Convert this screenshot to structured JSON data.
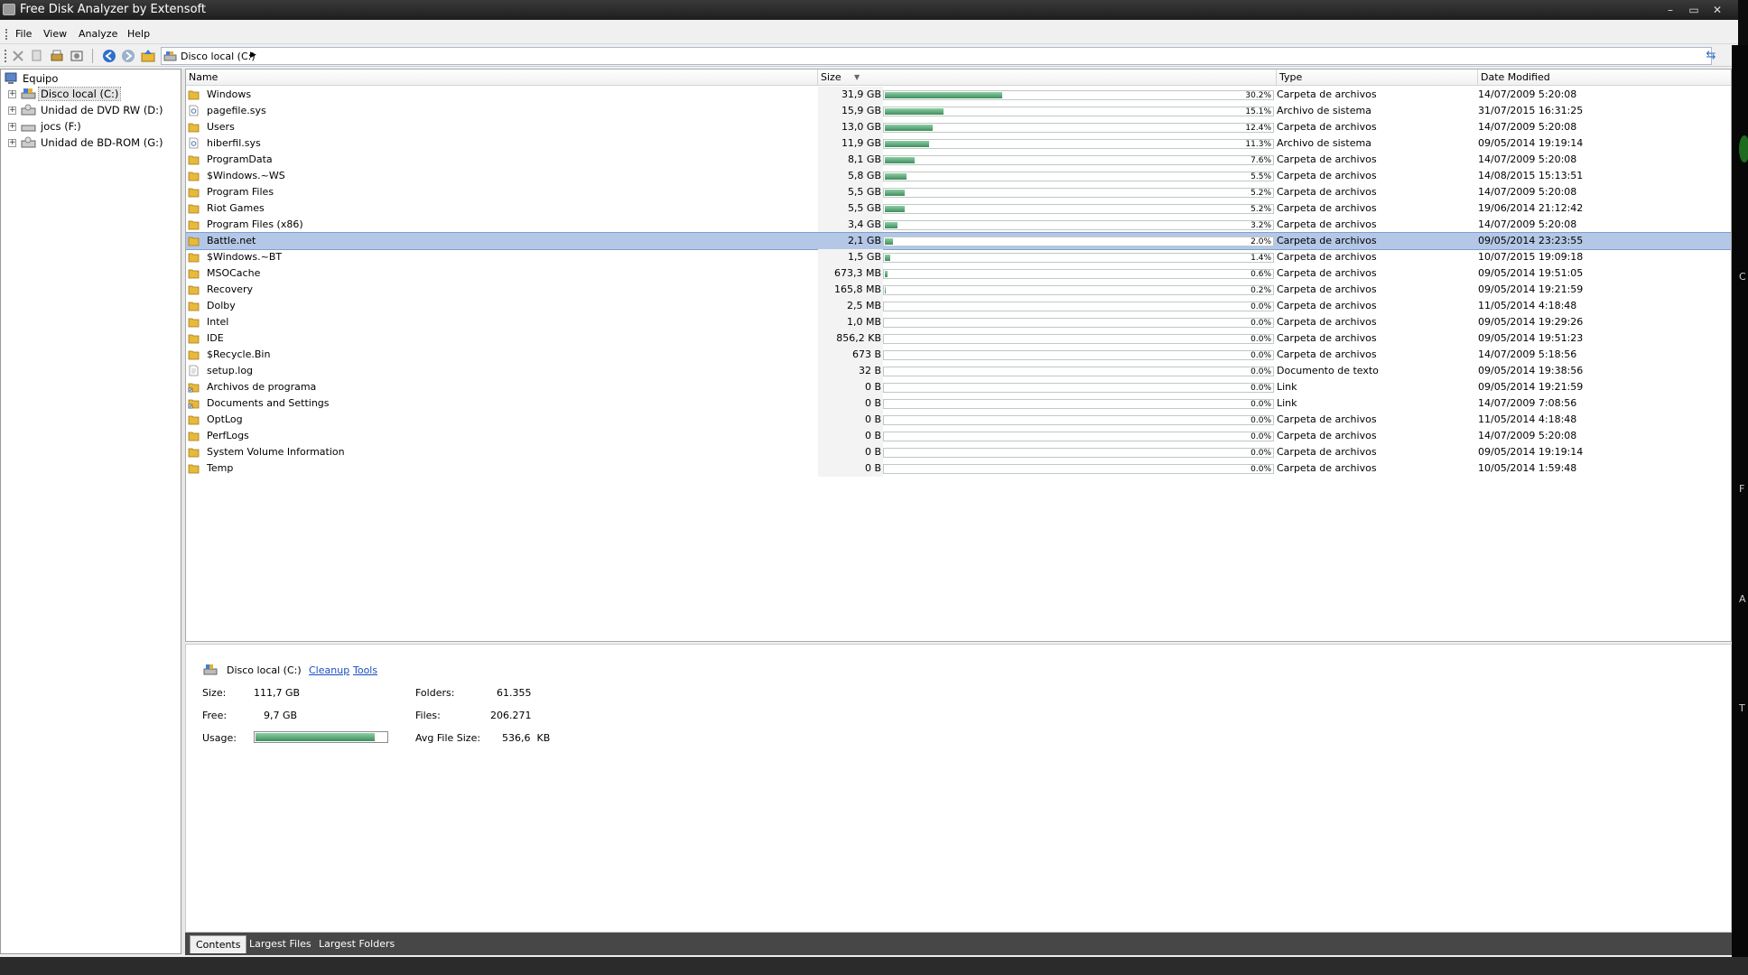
{
  "window": {
    "title": "Free Disk Analyzer by Extensoft",
    "controls": {
      "minimize": "–",
      "restore": "▭",
      "close": "✕"
    }
  },
  "menu": {
    "items": [
      "File",
      "View",
      "Analyze",
      "Help"
    ]
  },
  "address": {
    "path": "Disco local (C:)",
    "arrow": "▶"
  },
  "tree": {
    "root": "Equipo",
    "items": [
      {
        "label": "Disco local (C:)",
        "selected": true
      },
      {
        "label": "Unidad de DVD RW (D:)"
      },
      {
        "label": "jocs (F:)"
      },
      {
        "label": "Unidad de BD-ROM (G:)"
      }
    ]
  },
  "list": {
    "columns": {
      "name": "Name",
      "size": "Size",
      "type": "Type",
      "date": "Date Modified"
    },
    "rows": [
      {
        "name": "Windows",
        "icon": "folder",
        "size": "31,9 GB",
        "pct": "30.2%",
        "frac": 0.302,
        "type": "Carpeta de archivos",
        "date": "14/07/2009 5:20:08"
      },
      {
        "name": "pagefile.sys",
        "icon": "system-file",
        "size": "15,9 GB",
        "pct": "15.1%",
        "frac": 0.151,
        "type": "Archivo de sistema",
        "date": "31/07/2015 16:31:25"
      },
      {
        "name": "Users",
        "icon": "folder",
        "size": "13,0 GB",
        "pct": "12.4%",
        "frac": 0.124,
        "type": "Carpeta de archivos",
        "date": "14/07/2009 5:20:08"
      },
      {
        "name": "hiberfil.sys",
        "icon": "system-file",
        "size": "11,9 GB",
        "pct": "11.3%",
        "frac": 0.113,
        "type": "Archivo de sistema",
        "date": "09/05/2014 19:19:14"
      },
      {
        "name": "ProgramData",
        "icon": "folder",
        "size": "8,1 GB",
        "pct": "7.6%",
        "frac": 0.076,
        "type": "Carpeta de archivos",
        "date": "14/07/2009 5:20:08"
      },
      {
        "name": "$Windows.~WS",
        "icon": "folder",
        "size": "5,8 GB",
        "pct": "5.5%",
        "frac": 0.055,
        "type": "Carpeta de archivos",
        "date": "14/08/2015 15:13:51"
      },
      {
        "name": "Program Files",
        "icon": "folder",
        "size": "5,5 GB",
        "pct": "5.2%",
        "frac": 0.052,
        "type": "Carpeta de archivos",
        "date": "14/07/2009 5:20:08"
      },
      {
        "name": "Riot Games",
        "icon": "folder",
        "size": "5,5 GB",
        "pct": "5.2%",
        "frac": 0.052,
        "type": "Carpeta de archivos",
        "date": "19/06/2014 21:12:42"
      },
      {
        "name": "Program Files (x86)",
        "icon": "folder",
        "size": "3,4 GB",
        "pct": "3.2%",
        "frac": 0.032,
        "type": "Carpeta de archivos",
        "date": "14/07/2009 5:20:08"
      },
      {
        "name": "Battle.net",
        "icon": "folder",
        "size": "2,1 GB",
        "pct": "2.0%",
        "frac": 0.02,
        "type": "Carpeta de archivos",
        "date": "09/05/2014 23:23:55",
        "selected": true
      },
      {
        "name": "$Windows.~BT",
        "icon": "folder",
        "size": "1,5 GB",
        "pct": "1.4%",
        "frac": 0.014,
        "type": "Carpeta de archivos",
        "date": "10/07/2015 19:09:18"
      },
      {
        "name": "MSOCache",
        "icon": "folder",
        "size": "673,3 MB",
        "pct": "0.6%",
        "frac": 0.006,
        "type": "Carpeta de archivos",
        "date": "09/05/2014 19:51:05"
      },
      {
        "name": "Recovery",
        "icon": "folder",
        "size": "165,8 MB",
        "pct": "0.2%",
        "frac": 0.002,
        "type": "Carpeta de archivos",
        "date": "09/05/2014 19:21:59"
      },
      {
        "name": "Dolby",
        "icon": "folder",
        "size": "2,5 MB",
        "pct": "0.0%",
        "frac": 0,
        "type": "Carpeta de archivos",
        "date": "11/05/2014 4:18:48"
      },
      {
        "name": "Intel",
        "icon": "folder",
        "size": "1,0 MB",
        "pct": "0.0%",
        "frac": 0,
        "type": "Carpeta de archivos",
        "date": "09/05/2014 19:29:26"
      },
      {
        "name": "IDE",
        "icon": "folder",
        "size": "856,2 KB",
        "pct": "0.0%",
        "frac": 0,
        "type": "Carpeta de archivos",
        "date": "09/05/2014 19:51:23"
      },
      {
        "name": "$Recycle.Bin",
        "icon": "folder",
        "size": "673 B",
        "pct": "0.0%",
        "frac": 0,
        "type": "Carpeta de archivos",
        "date": "14/07/2009 5:18:56"
      },
      {
        "name": "setup.log",
        "icon": "text-file",
        "size": "32 B",
        "pct": "0.0%",
        "frac": 0,
        "type": "Documento de texto",
        "date": "09/05/2014 19:38:56"
      },
      {
        "name": "Archivos de programa",
        "icon": "folder-link",
        "size": "0 B",
        "pct": "0.0%",
        "frac": 0,
        "type": "Link",
        "date": "09/05/2014 19:21:59"
      },
      {
        "name": "Documents and Settings",
        "icon": "folder-link",
        "size": "0 B",
        "pct": "0.0%",
        "frac": 0,
        "type": "Link",
        "date": "14/07/2009 7:08:56"
      },
      {
        "name": "OptLog",
        "icon": "folder",
        "size": "0 B",
        "pct": "0.0%",
        "frac": 0,
        "type": "Carpeta de archivos",
        "date": "11/05/2014 4:18:48"
      },
      {
        "name": "PerfLogs",
        "icon": "folder",
        "size": "0 B",
        "pct": "0.0%",
        "frac": 0,
        "type": "Carpeta de archivos",
        "date": "14/07/2009 5:20:08"
      },
      {
        "name": "System Volume Information",
        "icon": "folder",
        "size": "0 B",
        "pct": "0.0%",
        "frac": 0,
        "type": "Carpeta de archivos",
        "date": "09/05/2014 19:19:14"
      },
      {
        "name": "Temp",
        "icon": "folder",
        "size": "0 B",
        "pct": "0.0%",
        "frac": 0,
        "type": "Carpeta de archivos",
        "date": "10/05/2014 1:59:48"
      }
    ]
  },
  "info": {
    "drive": "Disco local (C:)",
    "cleanup": "Cleanup",
    "tools": "Tools",
    "size_label": "Size:",
    "size_value": "111,7 GB",
    "free_label": "Free:",
    "free_value": "9,7 GB",
    "usage_label": "Usage:",
    "usage_fraction": 0.913,
    "folders_label": "Folders:",
    "folders_value": "61.355",
    "files_label": "Files:",
    "files_value": "206.271",
    "avg_label": "Avg File Size:",
    "avg_value": "536,6  KB"
  },
  "tabs": [
    "Contents",
    "Largest Files",
    "Largest Folders"
  ],
  "colors": {
    "bar_fill": "#4f9b6c",
    "selection": "#b4c7e6",
    "folder": "#e8b93a",
    "link": "#1a4ec1"
  }
}
